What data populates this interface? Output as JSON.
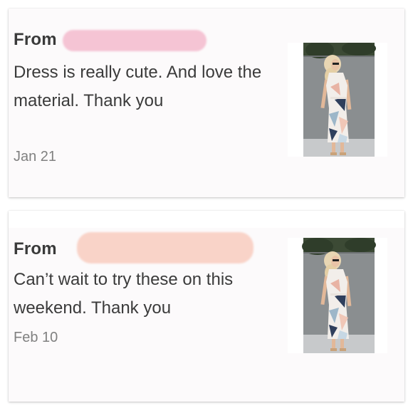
{
  "reviews": [
    {
      "from_label": "From",
      "message": "Dress is really cute. And love the material. Thank you",
      "date": "Jan 21",
      "thumbnail_icon": "dress-photo-icon"
    },
    {
      "from_label": "From",
      "message": "Can’t wait to try these on this weekend. Thank you",
      "date": "Feb 10",
      "thumbnail_icon": "dress-photo-icon"
    }
  ],
  "colors": {
    "card_bg": "#fcfafb",
    "text": "#3b3b3b",
    "date_text": "#808080",
    "redact_1": "#f5c4d4",
    "redact_2": "#f9d3c8"
  }
}
